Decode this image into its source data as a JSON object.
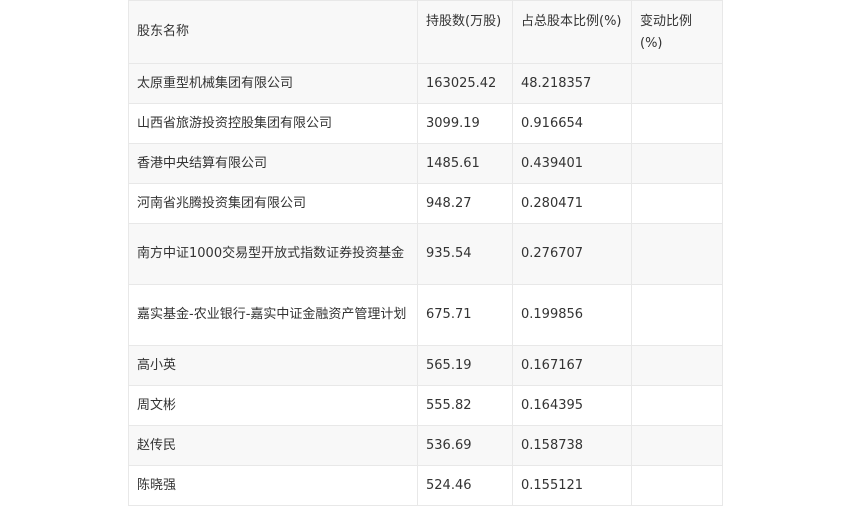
{
  "table": {
    "headers": [
      "股东名称",
      "持股数(万股)",
      "占总股本比例(%)",
      "变动比例(%)"
    ],
    "rows": [
      {
        "name": "太原重型机械集团有限公司",
        "shares": "163025.42",
        "ratio": "48.218357",
        "change": ""
      },
      {
        "name": "山西省旅游投资控股集团有限公司",
        "shares": "3099.19",
        "ratio": "0.916654",
        "change": ""
      },
      {
        "name": "香港中央结算有限公司",
        "shares": "1485.61",
        "ratio": "0.439401",
        "change": ""
      },
      {
        "name": "河南省兆腾投资集团有限公司",
        "shares": "948.27",
        "ratio": "0.280471",
        "change": ""
      },
      {
        "name": "南方中证1000交易型开放式指数证券投资基金",
        "shares": "935.54",
        "ratio": "0.276707",
        "change": ""
      },
      {
        "name": "嘉实基金-农业银行-嘉实中证金融资产管理计划",
        "shares": "675.71",
        "ratio": "0.199856",
        "change": ""
      },
      {
        "name": "高小英",
        "shares": "565.19",
        "ratio": "0.167167",
        "change": ""
      },
      {
        "name": "周文彬",
        "shares": "555.82",
        "ratio": "0.164395",
        "change": ""
      },
      {
        "name": "赵传民",
        "shares": "536.69",
        "ratio": "0.158738",
        "change": ""
      },
      {
        "name": "陈晓强",
        "shares": "524.46",
        "ratio": "0.155121",
        "change": ""
      }
    ]
  }
}
